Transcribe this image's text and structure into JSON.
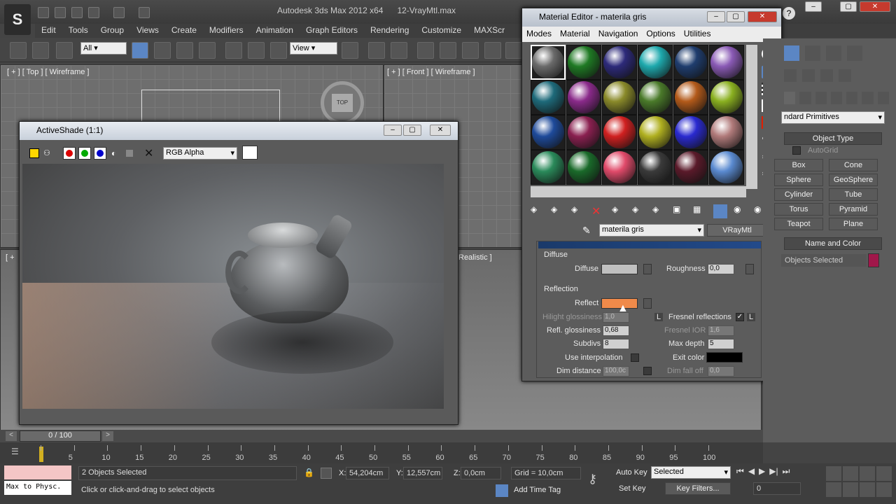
{
  "app": {
    "title": "Autodesk 3ds Max  2012 x64",
    "file": "12-VrayMtl.max",
    "logo": "S"
  },
  "menus": [
    "Edit",
    "Tools",
    "Group",
    "Views",
    "Create",
    "Modifiers",
    "Animation",
    "Graph Editors",
    "Rendering",
    "Customize",
    "MAXScr"
  ],
  "toolbar": {
    "filter": "All",
    "refcoord": "View"
  },
  "viewports": {
    "top": "[ + ] [ Top ] [ Wireframe ]",
    "front": "[ + ] [ Front ] [ Wireframe ]",
    "persp_tail": "Realistic ]",
    "left_plus": "[ +",
    "viewcube": "TOP"
  },
  "activeshade": {
    "title": "ActiveShade (1:1)",
    "channel": "RGB Alpha"
  },
  "mateditor": {
    "title": "Material Editor - materila gris",
    "menus": [
      "Modes",
      "Material",
      "Navigation",
      "Options",
      "Utilities"
    ],
    "material_name": "materila gris",
    "material_type": "VRayMtl",
    "spheres": [
      "#6a6a6a",
      "#1f7a24",
      "#2d2a7a",
      "#1ea9ad",
      "#1f3d6e",
      "#8a5ab5",
      "#1e6a7a",
      "#8a2a8a",
      "#8a8a2a",
      "#4a7a2a",
      "#b35a1a",
      "#8ab020",
      "#1e4a9a",
      "#8a2050",
      "#d02020",
      "#b0b020",
      "#2a2ad0",
      "#b07a7a",
      "#2a8a5a",
      "#1a6a2a",
      "#e04a6a",
      "#3a3a3a",
      "#5a1a2a",
      "#5a8ad0"
    ],
    "diffuse_section": "Diffuse",
    "diffuse_label": "Diffuse",
    "roughness_label": "Roughness",
    "roughness": "0,0",
    "reflection_section": "Reflection",
    "reflect_label": "Reflect",
    "hilight_label": "Hilight glossiness",
    "hilight": "1,0",
    "hilight_lock": "L",
    "fresnel_label": "Fresnel reflections",
    "fresnel_lock": "L",
    "reflgloss_label": "Refl. glossiness",
    "reflgloss": "0,68",
    "fresnelior_label": "Fresnel IOR",
    "fresnelior": "1,6",
    "subdivs_label": "Subdivs",
    "subdivs": "8",
    "maxdepth_label": "Max depth",
    "maxdepth": "5",
    "useinterp_label": "Use interpolation",
    "exitcolor_label": "Exit color",
    "dimdist_label": "Dim distance",
    "dimdist": "100,0c",
    "dimfalloff_label": "Dim fall off",
    "dimfalloff": "0,0",
    "colors": {
      "diffuse": "#c0c0c0",
      "reflect": "#f08a4a",
      "exit": "#000000"
    }
  },
  "cmdpanel": {
    "category": "ndard Primitives",
    "object_type": "Object Type",
    "autogrid": "AutoGrid",
    "buttons": [
      "Box",
      "Cone",
      "Sphere",
      "GeoSphere",
      "Cylinder",
      "Tube",
      "Torus",
      "Pyramid",
      "Teapot",
      "Plane"
    ],
    "name_color": "Name and Color",
    "selection_text": "Objects Selected",
    "object_color": "#a0174a"
  },
  "timeline": {
    "frame": "0 / 100",
    "ticks": [
      "0",
      "5",
      "10",
      "15",
      "20",
      "25",
      "30",
      "35",
      "40",
      "45",
      "50",
      "55",
      "60",
      "65",
      "70",
      "75",
      "80",
      "85",
      "90",
      "95",
      "100"
    ]
  },
  "status": {
    "selected": "2 Objects Selected",
    "prompt": "Click or click-and-drag to select objects",
    "x_label": "X:",
    "x": "54,204cm",
    "y_label": "Y:",
    "y": "12,557cm",
    "z_label": "Z:",
    "z": "0,0cm",
    "grid": "Grid = 10,0cm",
    "autokey": "Auto Key",
    "setkey": "Set Key",
    "keymode": "Selected",
    "keyfilters": "Key Filters...",
    "addtimetag": "Add Time Tag",
    "frame": "0",
    "maxscript": "Max to Physc."
  }
}
